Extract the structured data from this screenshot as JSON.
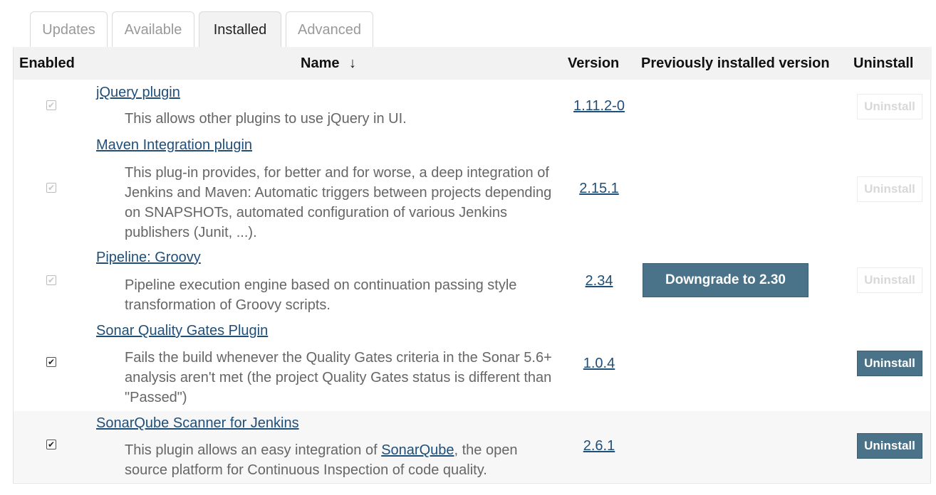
{
  "tabs": [
    {
      "label": "Updates",
      "active": false
    },
    {
      "label": "Available",
      "active": false
    },
    {
      "label": "Installed",
      "active": true
    },
    {
      "label": "Advanced",
      "active": false
    }
  ],
  "table": {
    "headers": {
      "enabled": "Enabled",
      "name": "Name",
      "sort_arrow": "↓",
      "version": "Version",
      "previous": "Previously installed version",
      "uninstall": "Uninstall"
    },
    "rows": [
      {
        "name": "jQuery plugin",
        "description": "This allows other plugins to use jQuery in UI.",
        "version": "1.11.2-0",
        "enabled": true,
        "checkbox_disabled": true,
        "downgrade": "",
        "uninstall_label": "Uninstall",
        "uninstall_disabled": true
      },
      {
        "name": "Maven Integration plugin",
        "description": "This plug-in provides, for better and for worse, a deep integration of Jenkins and Maven: Automatic triggers between projects depending on SNAPSHOTs, automated configuration of various Jenkins publishers (Junit, ...).",
        "version": "2.15.1",
        "enabled": true,
        "checkbox_disabled": true,
        "downgrade": "",
        "uninstall_label": "Uninstall",
        "uninstall_disabled": true
      },
      {
        "name": "Pipeline: Groovy",
        "description": "Pipeline execution engine based on continuation passing style transformation of Groovy scripts.",
        "version": "2.34",
        "enabled": true,
        "checkbox_disabled": true,
        "downgrade": "Downgrade to 2.30",
        "uninstall_label": "Uninstall",
        "uninstall_disabled": true
      },
      {
        "name": "Sonar Quality Gates Plugin",
        "description": "Fails the build whenever the Quality Gates criteria in the Sonar 5.6+ analysis aren't met (the project Quality Gates status is different than \"Passed\")",
        "version": "1.0.4",
        "enabled": true,
        "checkbox_disabled": false,
        "downgrade": "",
        "uninstall_label": "Uninstall",
        "uninstall_disabled": false
      },
      {
        "name": "SonarQube Scanner for Jenkins",
        "description_pre": "This plugin allows an easy integration of ",
        "description_link": "SonarQube",
        "description_post": ", the open source platform for Continuous Inspection of code quality.",
        "version": "2.6.1",
        "enabled": true,
        "checkbox_disabled": false,
        "downgrade": "",
        "uninstall_label": "Uninstall",
        "uninstall_disabled": false
      }
    ]
  },
  "colors": {
    "link": "#1f4e79",
    "button": "#4a7289",
    "header_bg": "#f2f2f2"
  }
}
